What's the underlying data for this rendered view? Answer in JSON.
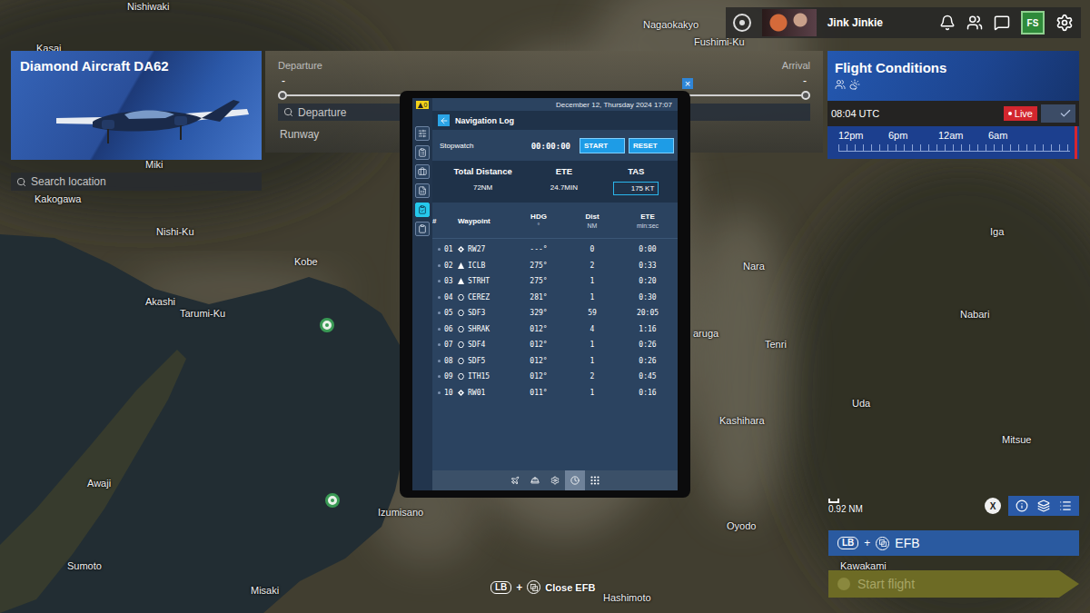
{
  "map": {
    "labels": [
      "Kasai",
      "Nishiwaki",
      "Nagaokakyo",
      "Fushimi-Ku",
      "Miki",
      "Kakogawa",
      "Nishi-Ku",
      "Kobe",
      "Akashi",
      "Tarumi-Ku",
      "Nara",
      "Iga",
      "Nabari",
      "Tenri",
      "aruga",
      "Uda",
      "Kashihara",
      "Mitsue",
      "Awaji",
      "Izumisano",
      "Oyodo",
      "Sumoto",
      "Misaki",
      "Hashimoto",
      "Kawakami"
    ],
    "scale": "0.92 NM"
  },
  "aircraft": {
    "name": "Diamond Aircraft DA62"
  },
  "search": {
    "placeholder": "Search location"
  },
  "flight_plan": {
    "departure_label": "Departure",
    "arrival_label": "Arrival",
    "departure_value": "-",
    "arrival_value": "-",
    "departure_placeholder": "Departure",
    "runway_label": "Runway",
    "close": "×"
  },
  "top_bar": {
    "user": "Jink Jinkie",
    "store": "FS"
  },
  "flight_conditions": {
    "title": "Flight Conditions",
    "time": "08:04 UTC",
    "live": "Live",
    "live_checked": true,
    "timeline": [
      "12pm",
      "6pm",
      "12am",
      "6am"
    ]
  },
  "efb": {
    "alerts": "0",
    "date": "December 12, Thursday 2024 17:07",
    "title": "Navigation Log",
    "sidebar": [
      {
        "selected": false
      },
      {
        "selected": false
      },
      {
        "selected": false
      },
      {
        "selected": false
      },
      {
        "selected": true
      },
      {
        "selected": false
      }
    ],
    "stopwatch": {
      "label": "Stopwatch",
      "time": "00:00:00",
      "start": "START",
      "reset": "RESET"
    },
    "totals": [
      {
        "label": "Total Distance",
        "value": "72NM",
        "kind": "text"
      },
      {
        "label": "ETE",
        "value": "24.7MIN",
        "kind": "text"
      },
      {
        "label": "TAS",
        "value": "175",
        "unit": "KT",
        "kind": "input"
      }
    ],
    "columns": [
      {
        "label": "#",
        "sub": ""
      },
      {
        "label": "Waypoint",
        "sub": ""
      },
      {
        "label": "HDG",
        "sub": "°"
      },
      {
        "label": "Dist",
        "sub": "NM"
      },
      {
        "label": "ETE",
        "sub": "min:sec"
      }
    ],
    "rows": [
      {
        "num": "01",
        "waypoint": "RW27",
        "kind": "runway",
        "hdg": "---°",
        "dist": "0",
        "ete": "0:00"
      },
      {
        "num": "02",
        "waypoint": "ICLB",
        "kind": "fix",
        "hdg": "275°",
        "dist": "2",
        "ete": "0:33"
      },
      {
        "num": "03",
        "waypoint": "STRHT",
        "kind": "fix",
        "hdg": "275°",
        "dist": "1",
        "ete": "0:20"
      },
      {
        "num": "04",
        "waypoint": "CEREZ",
        "kind": "waypoint",
        "hdg": "281°",
        "dist": "1",
        "ete": "0:30"
      },
      {
        "num": "05",
        "waypoint": "SDF3",
        "kind": "waypoint",
        "hdg": "329°",
        "dist": "59",
        "ete": "20:05"
      },
      {
        "num": "06",
        "waypoint": "SHRAK",
        "kind": "waypoint",
        "hdg": "012°",
        "dist": "4",
        "ete": "1:16"
      },
      {
        "num": "07",
        "waypoint": "SDF4",
        "kind": "waypoint",
        "hdg": "012°",
        "dist": "1",
        "ete": "0:26"
      },
      {
        "num": "08",
        "waypoint": "SDF5",
        "kind": "waypoint",
        "hdg": "012°",
        "dist": "1",
        "ete": "0:26"
      },
      {
        "num": "09",
        "waypoint": "ITH15",
        "kind": "waypoint",
        "hdg": "012°",
        "dist": "2",
        "ete": "0:45"
      },
      {
        "num": "10",
        "waypoint": "RW01",
        "kind": "runway",
        "hdg": "011°",
        "dist": "1",
        "ete": "0:16"
      }
    ],
    "bottom_tabs": [
      {
        "selected": false
      },
      {
        "selected": false
      },
      {
        "selected": false
      },
      {
        "selected": true
      },
      {
        "selected": false
      }
    ]
  },
  "hint": {
    "button": "LB",
    "plus": "+",
    "label": "Close EFB"
  },
  "bottom_right": {
    "close": "X",
    "efb": {
      "button": "LB",
      "plus": "+",
      "label": "EFB"
    },
    "start": "Start flight"
  }
}
